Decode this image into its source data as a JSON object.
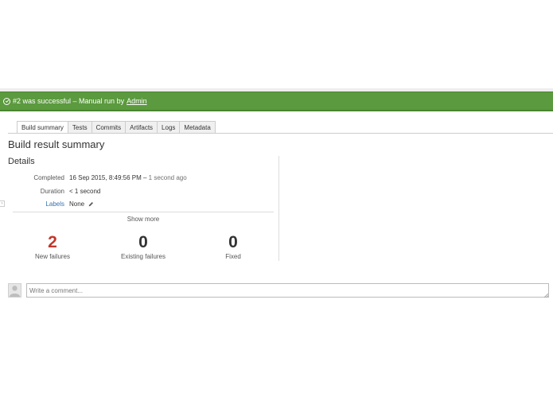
{
  "status_bar": {
    "prefix": "#2 was successful – Manual run by",
    "user": "Admin",
    "color": "#5b9a3e"
  },
  "tabs": [
    {
      "label": "Build summary",
      "active": true
    },
    {
      "label": "Tests"
    },
    {
      "label": "Commits"
    },
    {
      "label": "Artifacts"
    },
    {
      "label": "Logs"
    },
    {
      "label": "Metadata"
    }
  ],
  "page_title": "Build result summary",
  "details": {
    "title": "Details",
    "completed_label": "Completed",
    "completed_value": "16 Sep 2015, 8:49:56 PM –",
    "completed_ago": "1 second ago",
    "duration_label": "Duration",
    "duration_value": "< 1 second",
    "labels_label": "Labels",
    "labels_value": "None",
    "show_more": "Show more"
  },
  "stats": {
    "new_failures": {
      "value": "2",
      "label": "New failures",
      "color": "#c0392b"
    },
    "existing_failures": {
      "value": "0",
      "label": "Existing failures"
    },
    "fixed": {
      "value": "0",
      "label": "Fixed"
    }
  },
  "comment": {
    "placeholder": "Write a comment..."
  },
  "icons": [
    "check-circle-icon",
    "pencil-icon",
    "avatar-icon",
    "resize-grip-icon",
    "expand-handle-icon"
  ]
}
